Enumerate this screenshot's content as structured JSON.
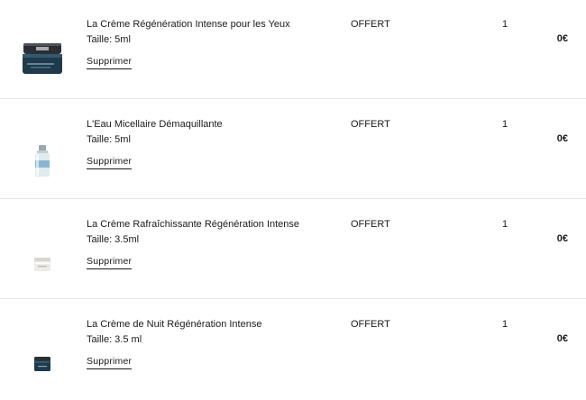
{
  "cart": {
    "items": [
      {
        "name": "La Crème Régénération Intense pour les Yeux",
        "size": "Taille: 5ml",
        "remove_label": "Supprimer",
        "status": "OFFERT",
        "quantity": "1",
        "price": "0€",
        "image_icon": "eye-cream-jar-icon"
      },
      {
        "name": "L'Eau Micellaire Démaquillante",
        "size": "Taille: 5ml",
        "remove_label": "Supprimer",
        "status": "OFFERT",
        "quantity": "1",
        "price": "0€",
        "image_icon": "micellar-water-bottle-icon"
      },
      {
        "name": "La Crème Rafraîchissante Régénération Intense",
        "size": "Taille: 3.5ml",
        "remove_label": "Supprimer",
        "status": "OFFERT",
        "quantity": "1",
        "price": "0€",
        "image_icon": "refreshing-cream-jar-icon"
      },
      {
        "name": "La Crème de Nuit Régénération Intense",
        "size": "Taille: 3.5 ml",
        "remove_label": "Supprimer",
        "status": "OFFERT",
        "quantity": "1",
        "price": "0€",
        "image_icon": "night-cream-jar-icon"
      }
    ]
  },
  "colors": {
    "text": "#1a1a1a",
    "separator": "#e4e4e4",
    "jar_dark": "#1f3a4a",
    "jar_cap": "#2a2f35"
  }
}
